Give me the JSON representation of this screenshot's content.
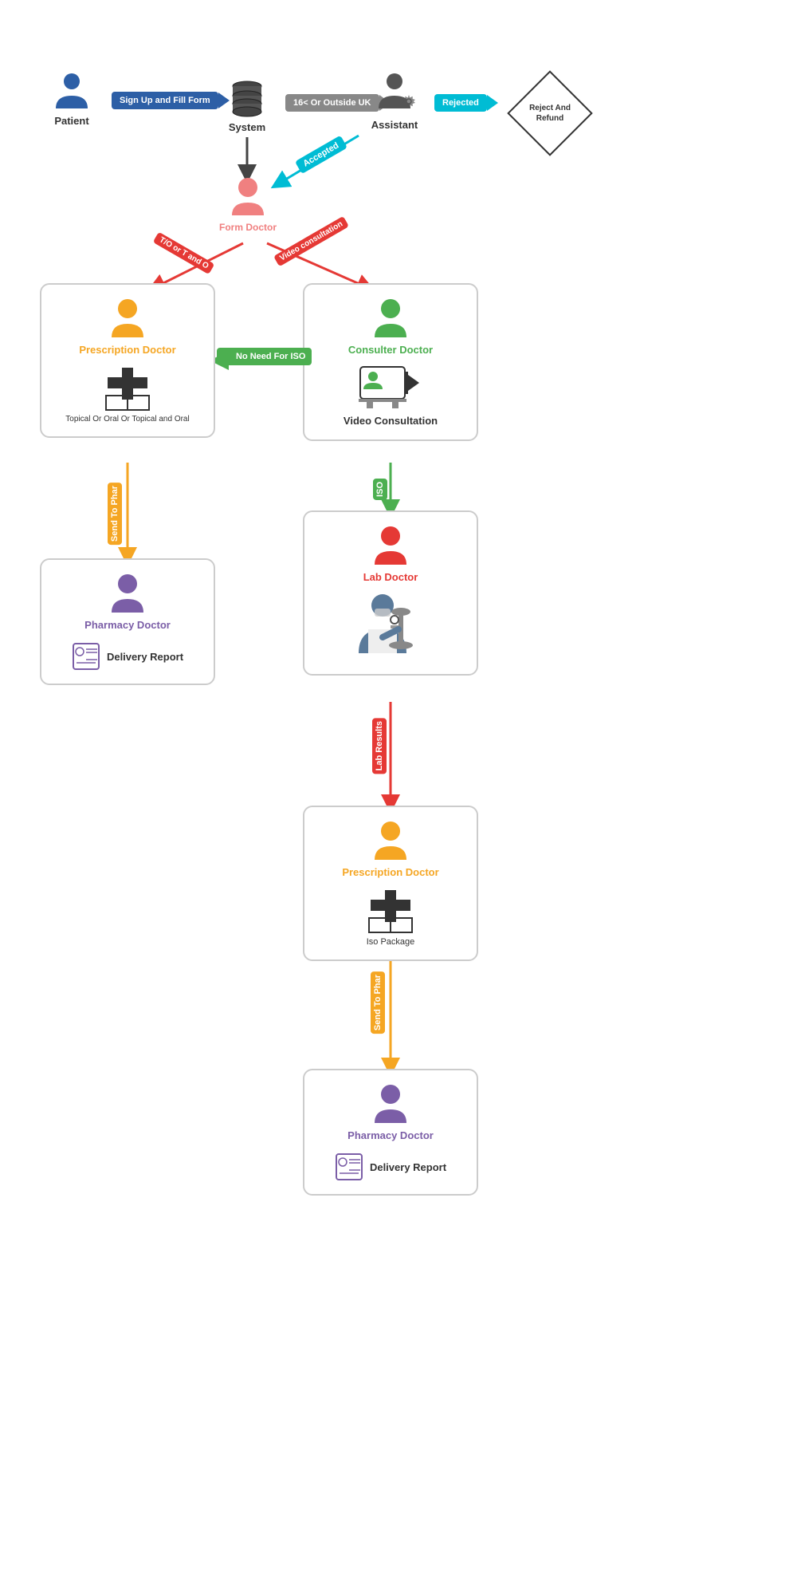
{
  "nodes": {
    "patient": {
      "label": "Patient",
      "icon": "👤"
    },
    "system": {
      "label": "System"
    },
    "assistant": {
      "label": "Assistant"
    },
    "formDoctor": {
      "label": "Form Doctor"
    },
    "prescriptionDoctor1": {
      "label": "Prescription Doctor"
    },
    "consulterDoctor": {
      "label": "Consulter Doctor"
    },
    "videoConsultation": {
      "label": "Video Consultation"
    },
    "pharmacyDoctor1": {
      "label": "Pharmacy Doctor"
    },
    "labDoctor": {
      "label": "Lab Doctor"
    },
    "prescriptionDoctor2": {
      "label": "Prescription Doctor"
    },
    "pharmacyDoctor2": {
      "label": "Pharmacy Doctor"
    },
    "rejectRefund": {
      "label": "Reject And\nRefund"
    }
  },
  "arrows": {
    "signUpForm": "Sign Up and Fill Form",
    "age16Outside": "16< Or Outside UK",
    "rejected": "Rejected",
    "accepted": "Accepted",
    "noNeedForISO": "No Need For ISO",
    "sendToPhar1": "Send To Phar",
    "sendToPhar2": "Send To Phar",
    "ISO": "ISO",
    "labResults": "Lab Results",
    "topicalOral": "T/O or T and O",
    "videoConsultationLabel": "Video consultation"
  },
  "subLabels": {
    "topicalOralFull": "Topical Or Oral Or Topical and Oral",
    "isoPackage": "Iso Package",
    "deliveryReport": "Delivery Report"
  }
}
